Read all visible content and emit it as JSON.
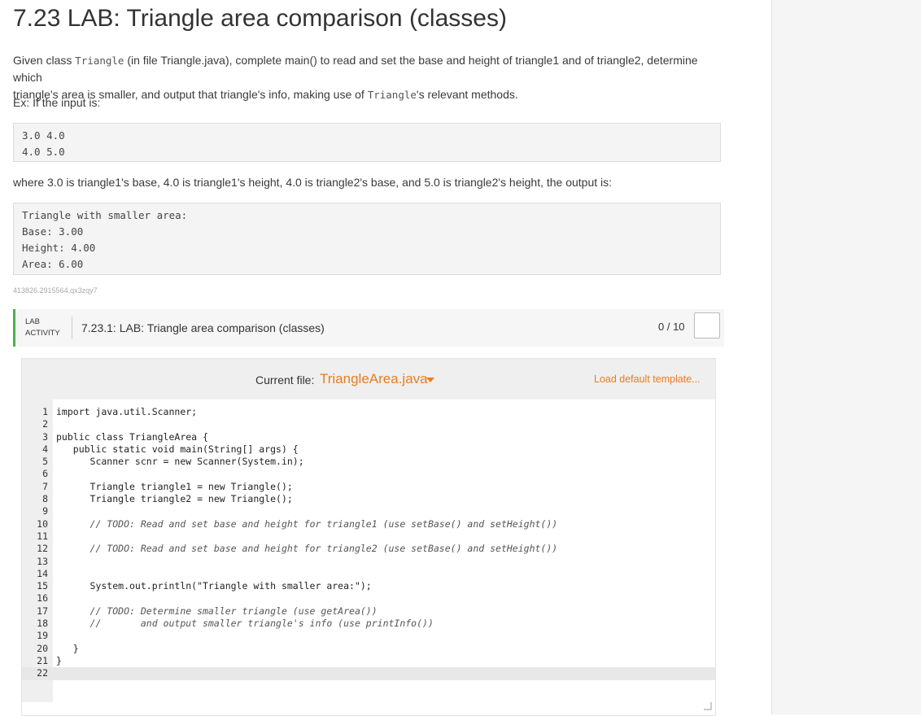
{
  "title": "7.23 LAB: Triangle area comparison (classes)",
  "intro": {
    "p1_a": "Given class ",
    "p1_code1": "Triangle",
    "p1_b": " (in file Triangle.java), complete main() to read and set the base and height of triangle1 and of triangle2, determine which",
    "p1_c": "triangle's area is smaller, and output that triangle's info, making use of ",
    "p1_code2": "Triangle",
    "p1_d": "'s relevant methods.",
    "p2": "Ex: If the input is:"
  },
  "input_example": "3.0 4.0\n4.0 5.0",
  "explanation": "where 3.0 is triangle1's base, 4.0 is triangle1's height, 4.0 is triangle2's base, and 5.0 is triangle2's height, the output is:",
  "output_example": "Triangle with smaller area:\nBase: 3.00\nHeight: 4.00\nArea: 6.00",
  "activity_id": "413826.2915564.qx3zqy7",
  "lab": {
    "label_line1": "LAB",
    "label_line2": "ACTIVITY",
    "title": "7.23.1: LAB: Triangle area comparison (classes)",
    "score": "0 / 10"
  },
  "editor": {
    "current_file_label": "Current file:",
    "current_file": "TriangleArea.java",
    "load_template": "Load default template...",
    "lines": [
      "import java.util.Scanner;",
      "",
      "public class TriangleArea {",
      "   public static void main(String[] args) {",
      "      Scanner scnr = new Scanner(System.in);",
      "",
      "      Triangle triangle1 = new Triangle();",
      "      Triangle triangle2 = new Triangle();",
      "",
      "      // TODO: Read and set base and height for triangle1 (use setBase() and setHeight())",
      "",
      "      // TODO: Read and set base and height for triangle2 (use setBase() and setHeight())",
      "",
      "",
      "      System.out.println(\"Triangle with smaller area:\");",
      "",
      "      // TODO: Determine smaller triangle (use getArea())",
      "      //       and output smaller triangle's info (use printInfo())",
      "",
      "   }",
      "}",
      ""
    ],
    "active_line": 22
  }
}
